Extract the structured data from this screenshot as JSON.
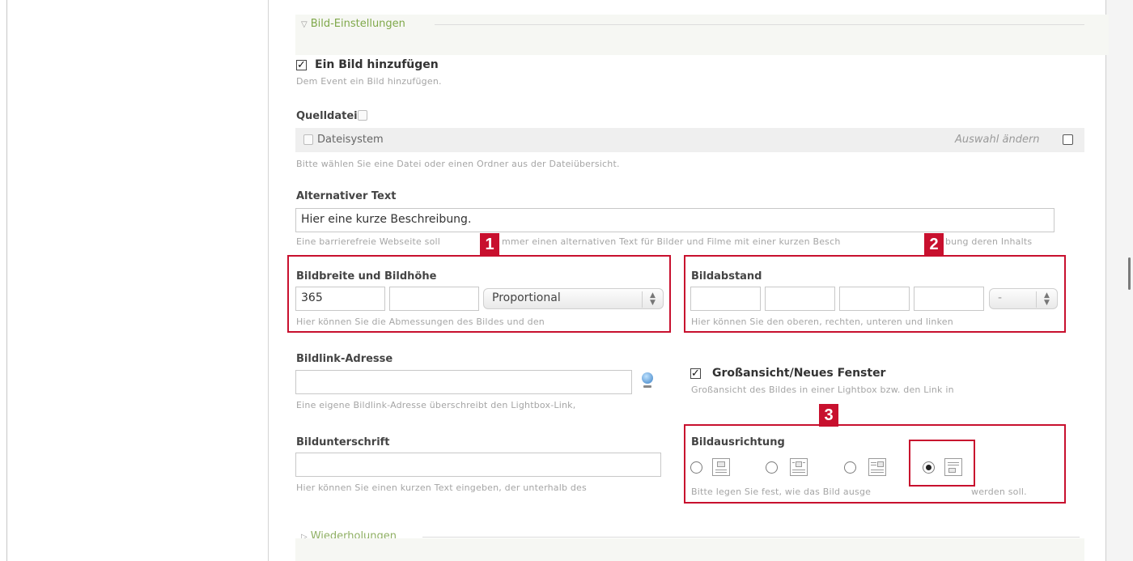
{
  "sections": {
    "image_settings": "Bild-Einstellungen",
    "repetitions": "Wiederholungen"
  },
  "add_image": {
    "title": "Ein Bild hinzufügen",
    "help": "Dem Event ein Bild hinzufügen.",
    "checked": true
  },
  "source": {
    "label": "Quelldatei",
    "file": "Dateisystem",
    "change": "Auswahl ändern",
    "help": "Bitte wählen Sie eine Datei oder einen Ordner aus der Dateiübersicht."
  },
  "alt_text": {
    "label": "Alternativer Text",
    "value": "Hier eine kurze Beschreibung.",
    "help_a": "Eine barrierefreie Webseite soll",
    "help_b": "mmer einen alternativen Text für Bilder und Filme mit einer kurzen Besch",
    "help_c": "bung deren Inhalts"
  },
  "size": {
    "label": "Bildbreite und Bildhöhe",
    "width": "365",
    "height": "",
    "mode": "Proportional",
    "help": "Hier können Sie die Abmessungen des Bildes und den"
  },
  "spacing": {
    "label": "Bildabstand",
    "top": "",
    "right": "",
    "bottom": "",
    "left": "",
    "unit": "-",
    "help": "Hier können Sie den oberen, rechten, unteren und linken"
  },
  "link": {
    "label": "Bildlink-Adresse",
    "value": "",
    "help": "Eine eigene Bildlink-Adresse überschreibt den Lightbox-Link,"
  },
  "lightbox": {
    "title": "Großansicht/Neues Fenster",
    "help": "Großansicht des Bildes in einer Lightbox bzw. den Link in",
    "checked": true
  },
  "caption": {
    "label": "Bildunterschrift",
    "value": "",
    "help": "Hier können Sie einen kurzen Text eingeben, der unterhalb des"
  },
  "alignment": {
    "label": "Bildausrichtung",
    "help_a": "Bitte legen Sie fest, wie das Bild ausge",
    "help_b": "werden soll.",
    "selected_index": 3
  },
  "badges": [
    "1",
    "2",
    "3"
  ],
  "colors": {
    "accent_green": "#7fa84a",
    "highlight_red": "#c8102e"
  }
}
